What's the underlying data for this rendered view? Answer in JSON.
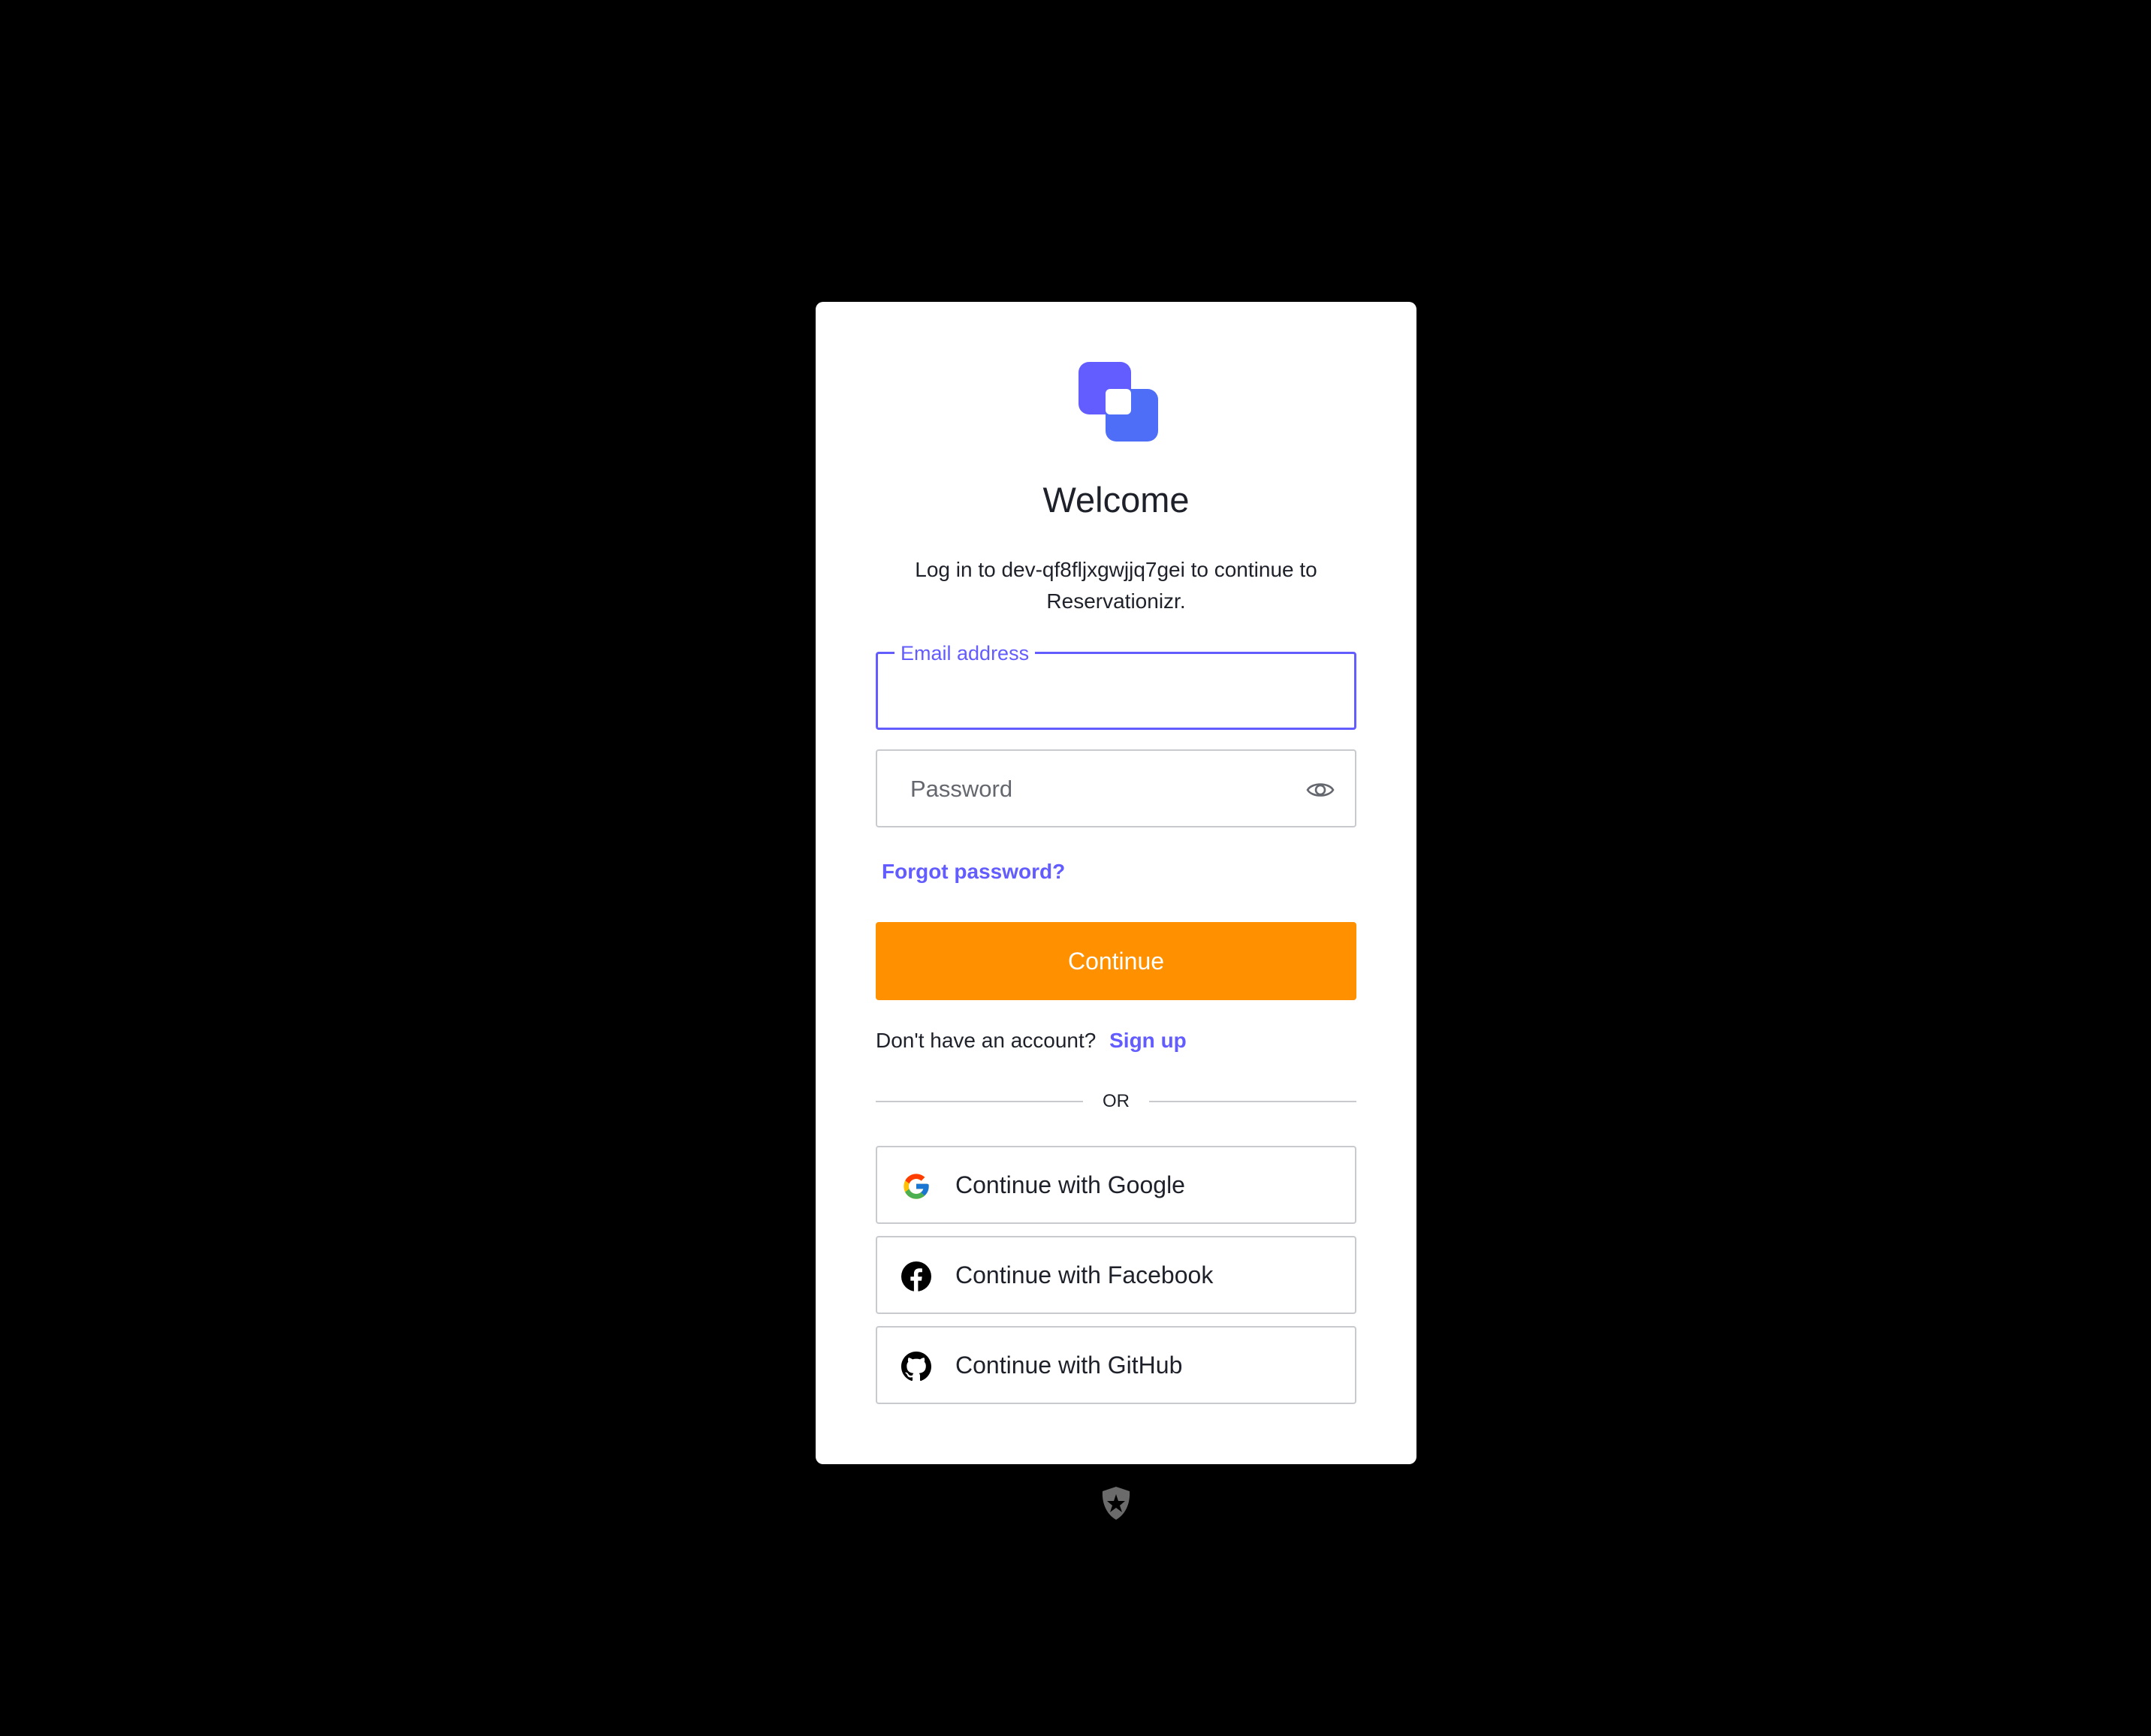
{
  "brand": {
    "logo_icon": "app-logo-icon",
    "accent_color": "#635dff",
    "primary_button_color": "#ff9100",
    "background_color": "#000000"
  },
  "header": {
    "title": "Welcome",
    "subtitle": "Log in to dev-qf8fljxgwjjq7gei to continue to Reservationizr."
  },
  "form": {
    "email_label": "Email address",
    "email_value": "",
    "password_placeholder": "Password",
    "password_toggle_icon": "eye-icon",
    "forgot_password": "Forgot password?",
    "continue_label": "Continue"
  },
  "signup": {
    "prompt": "Don't have an account?",
    "link": "Sign up"
  },
  "divider": {
    "label": "OR"
  },
  "social": [
    {
      "label": "Continue with Google",
      "icon": "google-icon"
    },
    {
      "label": "Continue with Facebook",
      "icon": "facebook-icon"
    },
    {
      "label": "Continue with GitHub",
      "icon": "github-icon"
    }
  ],
  "footer": {
    "badge_icon": "auth-provider-badge-icon"
  }
}
